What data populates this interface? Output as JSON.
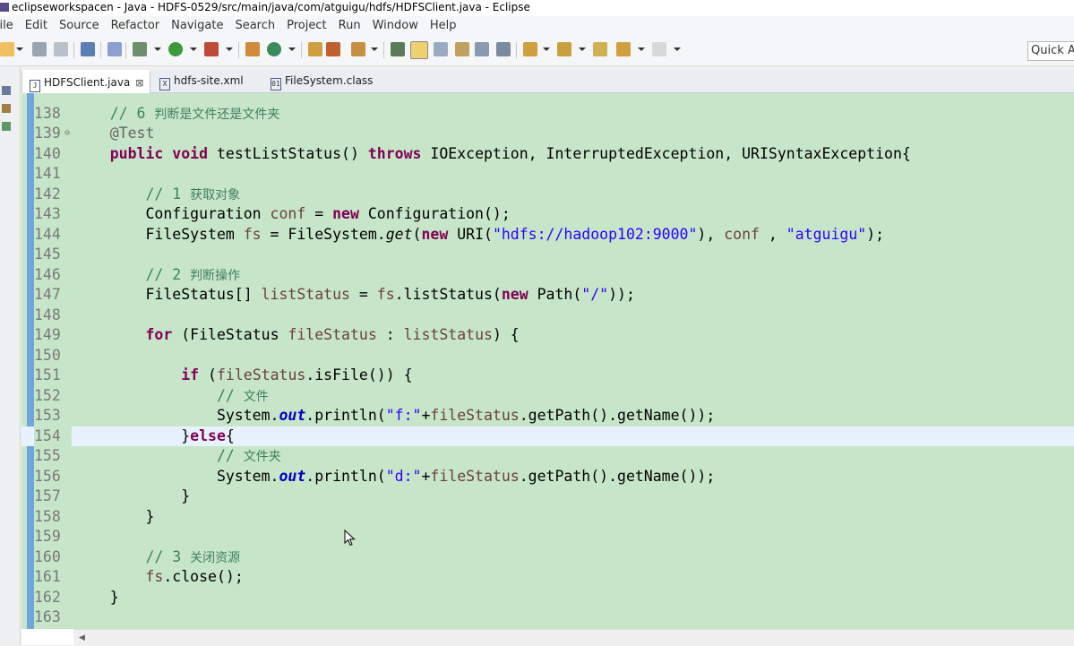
{
  "window": {
    "title": "eclipseworkspacen - Java - HDFS-0529/src/main/java/com/atguigu/hdfs/HDFSClient.java - Eclipse"
  },
  "menu": [
    "File",
    "Edit",
    "Source",
    "Refactor",
    "Navigate",
    "Search",
    "Project",
    "Run",
    "Window",
    "Help"
  ],
  "toolbar": {
    "quick_access": "Quick Ac"
  },
  "tabs": [
    {
      "label": "HDFSClient.java",
      "icon": "java-file-icon",
      "active": true,
      "close": "⊠"
    },
    {
      "label": "hdfs-site.xml",
      "icon": "xml-file-icon",
      "active": false
    },
    {
      "label": "FileSystem.class",
      "icon": "class-file-icon",
      "active": false
    }
  ],
  "editor": {
    "current_line": 154,
    "lines": [
      {
        "n": "138",
        "tokens": [
          [
            "    ",
            ""
          ],
          [
            "// 6 ",
            "cm"
          ],
          [
            "判断是文件还是文件夹",
            "cm cmz"
          ]
        ]
      },
      {
        "n": "139",
        "fold": "⊖",
        "tokens": [
          [
            "    ",
            ""
          ],
          [
            "@Test",
            "ann"
          ]
        ]
      },
      {
        "n": "140",
        "tokens": [
          [
            "    ",
            ""
          ],
          [
            "public",
            "kw"
          ],
          [
            " ",
            ""
          ],
          [
            "void",
            "kw"
          ],
          [
            " testListStatus() ",
            ""
          ],
          [
            "throws",
            "kw"
          ],
          [
            " IOException, InterruptedException, URISyntaxException{",
            ""
          ]
        ]
      },
      {
        "n": "141",
        "tokens": []
      },
      {
        "n": "142",
        "tokens": [
          [
            "        ",
            ""
          ],
          [
            "// 1 ",
            "cm"
          ],
          [
            "获取对象",
            "cm cmz"
          ]
        ]
      },
      {
        "n": "143",
        "tokens": [
          [
            "        Configuration ",
            ""
          ],
          [
            "conf",
            "fld"
          ],
          [
            " = ",
            ""
          ],
          [
            "new",
            "kw"
          ],
          [
            " Configuration();",
            ""
          ]
        ]
      },
      {
        "n": "144",
        "tokens": [
          [
            "        FileSystem ",
            ""
          ],
          [
            "fs",
            "fld"
          ],
          [
            " = FileSystem.",
            ""
          ],
          [
            "get",
            "ital"
          ],
          [
            "(",
            ""
          ],
          [
            "new",
            "kw"
          ],
          [
            " URI(",
            ""
          ],
          [
            "\"hdfs://hadoop102:9000\"",
            "st"
          ],
          [
            "), ",
            ""
          ],
          [
            "conf",
            "fld"
          ],
          [
            " , ",
            ""
          ],
          [
            "\"atguigu\"",
            "st"
          ],
          [
            ");",
            ""
          ]
        ]
      },
      {
        "n": "145",
        "tokens": []
      },
      {
        "n": "146",
        "tokens": [
          [
            "        ",
            ""
          ],
          [
            "// 2 ",
            "cm"
          ],
          [
            "判断操作",
            "cm cmz"
          ]
        ]
      },
      {
        "n": "147",
        "tokens": [
          [
            "        FileStatus[] ",
            ""
          ],
          [
            "listStatus",
            "fld"
          ],
          [
            " = ",
            ""
          ],
          [
            "fs",
            "fld"
          ],
          [
            ".listStatus(",
            ""
          ],
          [
            "new",
            "kw"
          ],
          [
            " Path(",
            ""
          ],
          [
            "\"/\"",
            "st"
          ],
          [
            "));",
            ""
          ]
        ]
      },
      {
        "n": "148",
        "tokens": []
      },
      {
        "n": "149",
        "tokens": [
          [
            "        ",
            ""
          ],
          [
            "for",
            "kw"
          ],
          [
            " (FileStatus ",
            ""
          ],
          [
            "fileStatus",
            "fld"
          ],
          [
            " : ",
            ""
          ],
          [
            "listStatus",
            "fld"
          ],
          [
            ") {",
            ""
          ]
        ]
      },
      {
        "n": "150",
        "tokens": []
      },
      {
        "n": "151",
        "tokens": [
          [
            "            ",
            ""
          ],
          [
            "if",
            "kw"
          ],
          [
            " (",
            ""
          ],
          [
            "fileStatus",
            "fld"
          ],
          [
            ".isFile()) {",
            ""
          ]
        ]
      },
      {
        "n": "152",
        "tokens": [
          [
            "                ",
            ""
          ],
          [
            "// ",
            "cm"
          ],
          [
            "文件",
            "cm cmz"
          ]
        ]
      },
      {
        "n": "153",
        "tokens": [
          [
            "                System.",
            ""
          ],
          [
            "out",
            "sfld"
          ],
          [
            ".println(",
            ""
          ],
          [
            "\"f:\"",
            "st"
          ],
          [
            "+",
            ""
          ],
          [
            "fileStatus",
            "fld"
          ],
          [
            ".getPath().getName());",
            ""
          ]
        ]
      },
      {
        "n": "154",
        "tokens": [
          [
            "            }",
            ""
          ],
          [
            "else",
            "kw"
          ],
          [
            "{",
            ""
          ]
        ]
      },
      {
        "n": "155",
        "tokens": [
          [
            "                ",
            ""
          ],
          [
            "// ",
            "cm"
          ],
          [
            "文件夹",
            "cm cmz"
          ]
        ]
      },
      {
        "n": "156",
        "tokens": [
          [
            "                System.",
            ""
          ],
          [
            "out",
            "sfld"
          ],
          [
            ".println(",
            ""
          ],
          [
            "\"d:\"",
            "st"
          ],
          [
            "+",
            ""
          ],
          [
            "fileStatus",
            "fld"
          ],
          [
            ".getPath().getName());",
            ""
          ]
        ]
      },
      {
        "n": "157",
        "tokens": [
          [
            "            }",
            ""
          ]
        ]
      },
      {
        "n": "158",
        "tokens": [
          [
            "        }",
            ""
          ]
        ]
      },
      {
        "n": "159",
        "tokens": []
      },
      {
        "n": "160",
        "tokens": [
          [
            "        ",
            ""
          ],
          [
            "// 3 ",
            "cm"
          ],
          [
            "关闭资源",
            "cm cmz"
          ]
        ]
      },
      {
        "n": "161",
        "tokens": [
          [
            "        ",
            ""
          ],
          [
            "fs",
            "fld"
          ],
          [
            ".close();",
            ""
          ]
        ]
      },
      {
        "n": "162",
        "tokens": [
          [
            "    }",
            ""
          ]
        ]
      },
      {
        "n": "163",
        "tokens": []
      }
    ]
  },
  "colors": {
    "editor_bg": "#c7e6c9",
    "current_line_bg": "#e8f2fe",
    "keyword": "#7f0055",
    "comment": "#3f7f5f",
    "string": "#2a00ff",
    "field": "#6a3e3e",
    "static_field": "#0000c0",
    "annotation": "#646464",
    "gutter_band": "#6fa4dc"
  }
}
